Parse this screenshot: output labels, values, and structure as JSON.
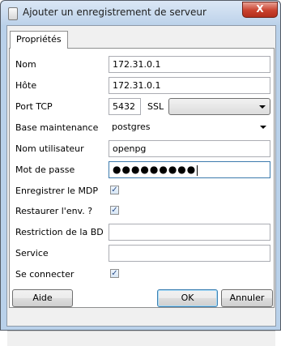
{
  "window": {
    "title": "Ajouter un enregistrement de serveur",
    "close_label": "X",
    "icon": "document-icon"
  },
  "tabs": [
    {
      "label": "Propriétés",
      "selected": true
    }
  ],
  "form": {
    "name": {
      "label": "Nom",
      "value": "172.31.0.1"
    },
    "host": {
      "label": "Hôte",
      "value": "172.31.0.1"
    },
    "port": {
      "label": "Port TCP",
      "value": "5432"
    },
    "ssl": {
      "label": "SSL",
      "value": ""
    },
    "maintenance_db": {
      "label": "Base maintenance",
      "value": "postgres"
    },
    "username": {
      "label": "Nom utilisateur",
      "value": "openpg"
    },
    "password": {
      "label": "Mot de passe",
      "value": "●●●●●●●●●"
    },
    "save_password": {
      "label": "Enregistrer le MDP",
      "checked": true
    },
    "restore_env": {
      "label": "Restaurer l'env. ?",
      "checked": true
    },
    "db_restriction": {
      "label": "Restriction de la BD",
      "value": ""
    },
    "service": {
      "label": "Service",
      "value": ""
    },
    "connect": {
      "label": "Se connecter",
      "checked": true
    }
  },
  "buttons": {
    "help": "Aide",
    "ok": "OK",
    "cancel": "Annuler"
  },
  "check_mark": "✓",
  "colors": {
    "title_bar": "#bcd2ea",
    "close_button": "#c9412e",
    "focus_border": "#3d7bad"
  }
}
